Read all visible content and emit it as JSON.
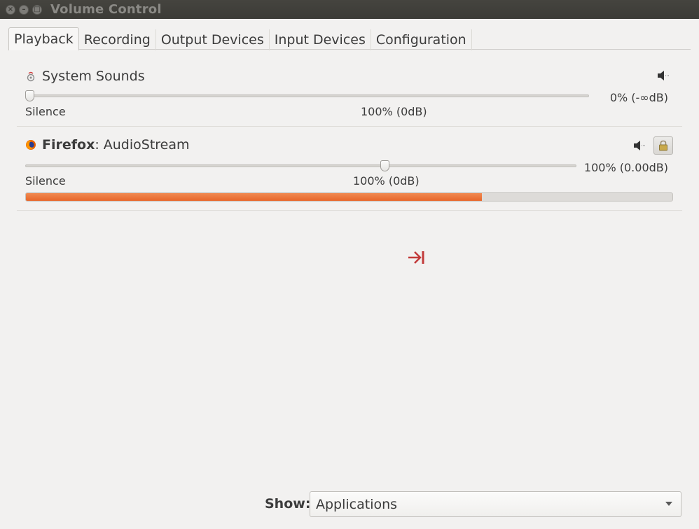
{
  "window": {
    "title": "Volume Control",
    "buttons": [
      "close-icon",
      "minimize-icon",
      "maximize-icon"
    ]
  },
  "tabs": [
    {
      "label": "Playback",
      "active": true
    },
    {
      "label": "Recording",
      "active": false
    },
    {
      "label": "Output Devices",
      "active": false
    },
    {
      "label": "Input Devices",
      "active": false
    },
    {
      "label": "Configuration",
      "active": false
    }
  ],
  "streams": [
    {
      "app_bold": "",
      "name": "System Sounds",
      "icon": "system-sounds-icon",
      "volume_text": "0% (-∞dB)",
      "volume_fraction": 0.0,
      "scale_left": "Silence",
      "scale_mid": "100% (0dB)",
      "mute_icon": "speaker-icon"
    },
    {
      "app_bold": "Firefox",
      "name": ": AudioStream",
      "icon": "firefox-icon",
      "volume_text": "100% (0.00dB)",
      "volume_fraction": 0.65,
      "scale_left": "Silence",
      "scale_mid": "100% (0dB)",
      "mute_icon": "speaker-icon",
      "lock_icon": "lock-icon",
      "peak_level_fraction": 0.705
    }
  ],
  "cursor_icon": "arrow-to-right-bar-icon",
  "footer": {
    "show_label": "Show:",
    "show_value": "Applications"
  },
  "colors": {
    "accent": "#e8662a",
    "cursor": "#c23a3a"
  }
}
